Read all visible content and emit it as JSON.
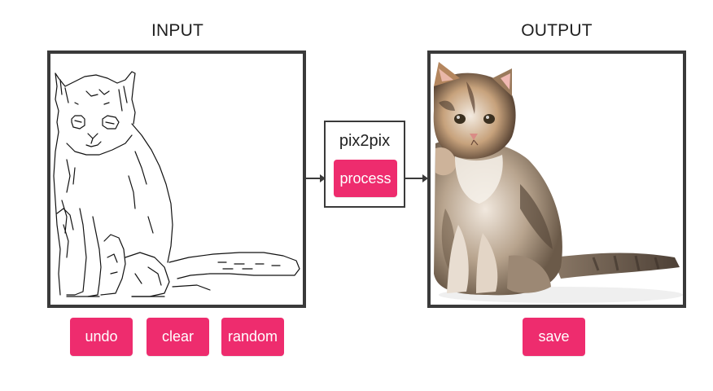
{
  "input_panel": {
    "title": "INPUT"
  },
  "output_panel": {
    "title": "OUTPUT"
  },
  "model": {
    "name": "pix2pix",
    "process_label": "process"
  },
  "controls": {
    "undo_label": "undo",
    "clear_label": "clear",
    "random_label": "random",
    "save_label": "save"
  },
  "colors": {
    "accent": "#ee2c6e",
    "frame": "#3a3a3a",
    "background": "#ffffff"
  }
}
